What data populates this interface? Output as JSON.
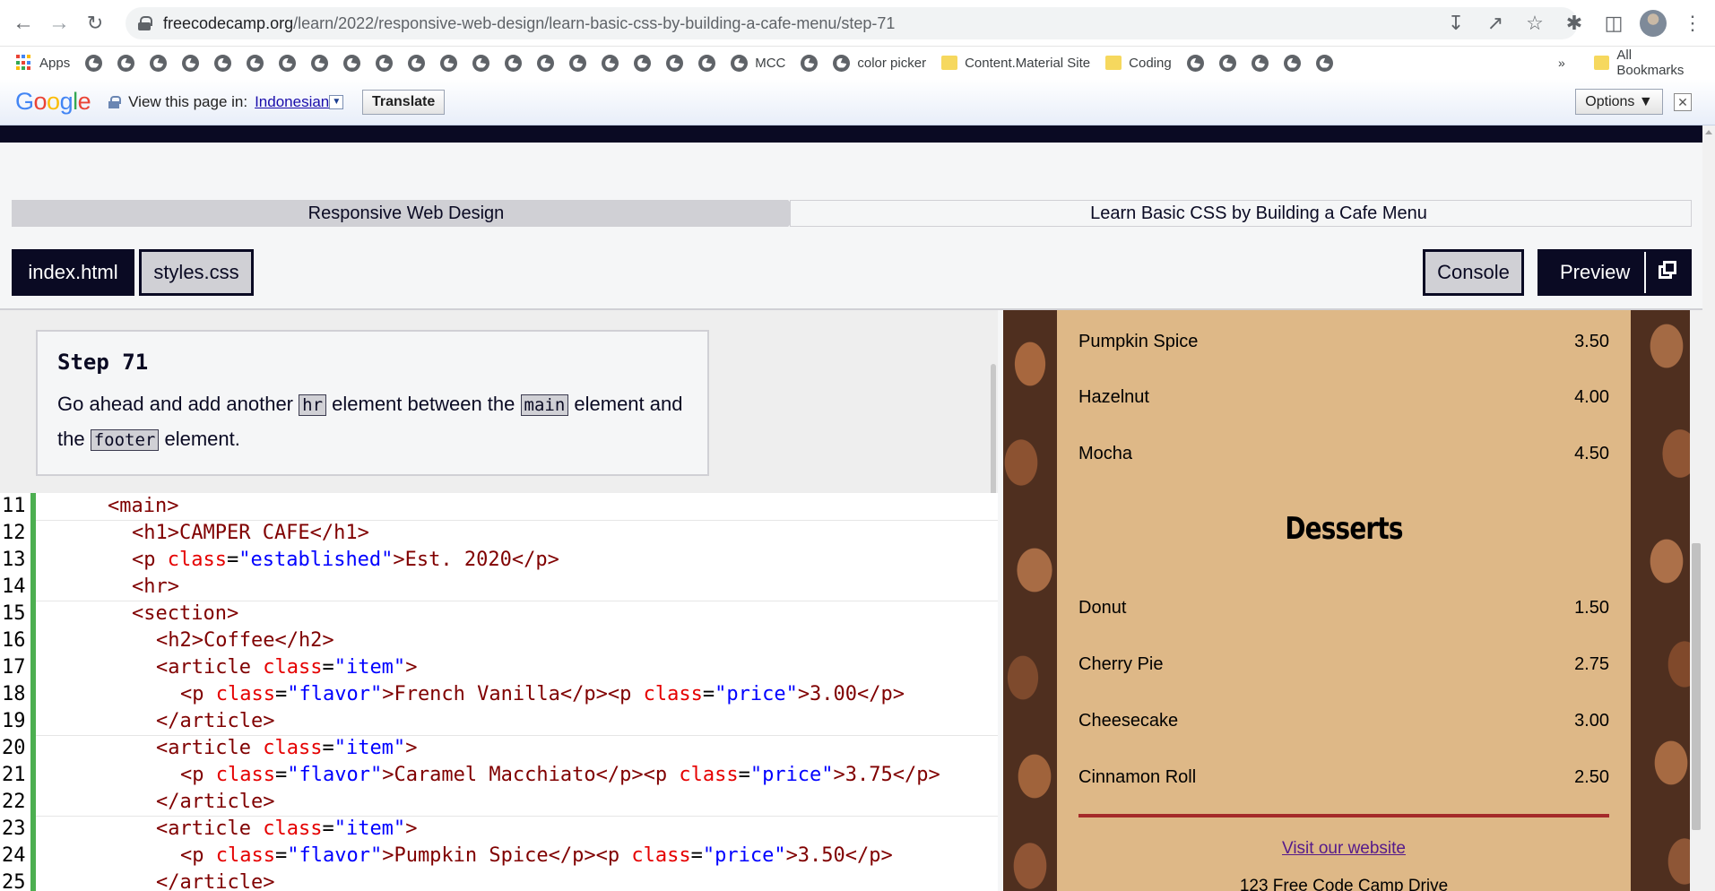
{
  "browser": {
    "url_host": "freecodecamp.org",
    "url_path": "/learn/2022/responsive-web-design/learn-basic-css-by-building-a-cafe-menu/step-71",
    "bookmarks": {
      "apps": "Apps",
      "mcc": "MCC",
      "color_picker": "color picker",
      "content_material": "Content.Material Site",
      "coding": "Coding",
      "more": "»",
      "all_bookmarks": "All Bookmarks"
    }
  },
  "translate_bar": {
    "logo": "Google",
    "prompt": "View this page in:",
    "language": "Indonesian",
    "translate_label": "Translate",
    "options_label": "Options ▼"
  },
  "breadcrumb": {
    "superblock": "Responsive Web Design",
    "block": "Learn Basic CSS by Building a Cafe Menu"
  },
  "tabs": {
    "html": "index.html",
    "css": "styles.css",
    "console": "Console",
    "preview": "Preview"
  },
  "step": {
    "title": "Step 71",
    "t1": "Go ahead and add another ",
    "c1": "hr",
    "t2": " element between the ",
    "c2": "main",
    "t3": " element and the ",
    "c3": "footer",
    "t4": " element."
  },
  "code_lines": [
    {
      "n": "11",
      "indent": 4
    },
    {
      "n": "12",
      "indent": 5
    },
    {
      "n": "13",
      "indent": 5
    },
    {
      "n": "14",
      "indent": 5
    },
    {
      "n": "15",
      "indent": 5
    },
    {
      "n": "16",
      "indent": 6
    },
    {
      "n": "17",
      "indent": 6
    },
    {
      "n": "18",
      "indent": 7
    },
    {
      "n": "19",
      "indent": 6
    },
    {
      "n": "20",
      "indent": 6
    },
    {
      "n": "21",
      "indent": 7
    },
    {
      "n": "22",
      "indent": 6
    },
    {
      "n": "23",
      "indent": 6
    },
    {
      "n": "24",
      "indent": 7
    },
    {
      "n": "25",
      "indent": 6
    }
  ],
  "code_text": {
    "l11": "<main>",
    "l12": "<h1>CAMPER CAFE</h1>",
    "l13a": "<p ",
    "l13b": "class",
    "l13c": "=",
    "l13d": "\"established\"",
    "l13e": ">Est. 2020</p>",
    "l14": "<hr>",
    "l15": "<section>",
    "l16": "<h2>Coffee</h2>",
    "l17a": "<article ",
    "l17b": "class",
    "l17c": "=",
    "l17d": "\"item\"",
    "l17e": ">",
    "l18a": "<p ",
    "l18b": "class",
    "l18c": "=",
    "l18d": "\"flavor\"",
    "l18e": ">French Vanilla</p><p ",
    "l18f": "class",
    "l18g": "=",
    "l18h": "\"price\"",
    "l18i": ">3.00</p>",
    "l19": "</article>",
    "l20a": "<article ",
    "l20b": "class",
    "l20c": "=",
    "l20d": "\"item\"",
    "l20e": ">",
    "l21a": "<p ",
    "l21b": "class",
    "l21c": "=",
    "l21d": "\"flavor\"",
    "l21e": ">Caramel Macchiato</p><p ",
    "l21f": "class",
    "l21g": "=",
    "l21h": "\"price\"",
    "l21i": ">3.75</p>",
    "l22": "</article>",
    "l23a": "<article ",
    "l23b": "class",
    "l23c": "=",
    "l23d": "\"item\"",
    "l23e": ">",
    "l24a": "<p ",
    "l24b": "class",
    "l24c": "=",
    "l24d": "\"flavor\"",
    "l24e": ">Pumpkin Spice</p><p ",
    "l24f": "class",
    "l24g": "=",
    "l24h": "\"price\"",
    "l24i": ">3.50</p>",
    "l25": "</article>"
  },
  "preview": {
    "coffee_items": [
      {
        "flavor": "Pumpkin Spice",
        "price": "3.50"
      },
      {
        "flavor": "Hazelnut",
        "price": "4.00"
      },
      {
        "flavor": "Mocha",
        "price": "4.50"
      }
    ],
    "desserts_heading": "Desserts",
    "dessert_items": [
      {
        "flavor": "Donut",
        "price": "1.50"
      },
      {
        "flavor": "Cherry Pie",
        "price": "2.75"
      },
      {
        "flavor": "Cheesecake",
        "price": "3.00"
      },
      {
        "flavor": "Cinnamon Roll",
        "price": "2.50"
      }
    ],
    "link_text": "Visit our website",
    "address": "123 Free Code Camp Drive"
  },
  "colors": {
    "fcc_dark": "#0a0a23",
    "menu_bg": "burlywood",
    "rule": "brown",
    "gutter_active": "#4caf50"
  }
}
